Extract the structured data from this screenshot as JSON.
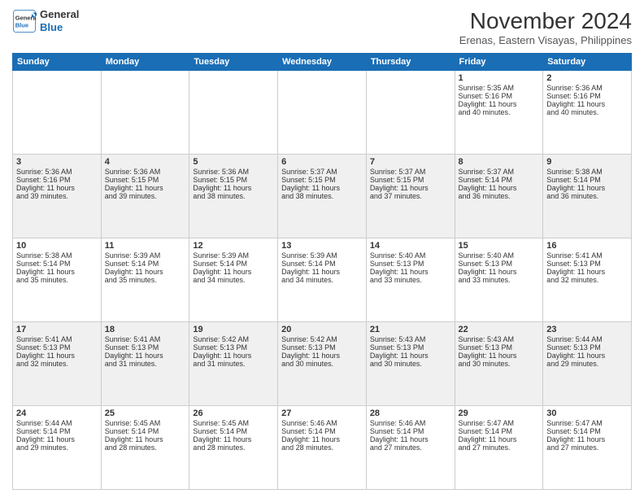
{
  "header": {
    "logo_line1": "General",
    "logo_line2": "Blue",
    "month": "November 2024",
    "location": "Erenas, Eastern Visayas, Philippines"
  },
  "weekdays": [
    "Sunday",
    "Monday",
    "Tuesday",
    "Wednesday",
    "Thursday",
    "Friday",
    "Saturday"
  ],
  "weeks": [
    [
      {
        "day": "",
        "info": ""
      },
      {
        "day": "",
        "info": ""
      },
      {
        "day": "",
        "info": ""
      },
      {
        "day": "",
        "info": ""
      },
      {
        "day": "",
        "info": ""
      },
      {
        "day": "1",
        "info": "Sunrise: 5:35 AM\nSunset: 5:16 PM\nDaylight: 11 hours\nand 40 minutes."
      },
      {
        "day": "2",
        "info": "Sunrise: 5:36 AM\nSunset: 5:16 PM\nDaylight: 11 hours\nand 40 minutes."
      }
    ],
    [
      {
        "day": "3",
        "info": "Sunrise: 5:36 AM\nSunset: 5:16 PM\nDaylight: 11 hours\nand 39 minutes."
      },
      {
        "day": "4",
        "info": "Sunrise: 5:36 AM\nSunset: 5:15 PM\nDaylight: 11 hours\nand 39 minutes."
      },
      {
        "day": "5",
        "info": "Sunrise: 5:36 AM\nSunset: 5:15 PM\nDaylight: 11 hours\nand 38 minutes."
      },
      {
        "day": "6",
        "info": "Sunrise: 5:37 AM\nSunset: 5:15 PM\nDaylight: 11 hours\nand 38 minutes."
      },
      {
        "day": "7",
        "info": "Sunrise: 5:37 AM\nSunset: 5:15 PM\nDaylight: 11 hours\nand 37 minutes."
      },
      {
        "day": "8",
        "info": "Sunrise: 5:37 AM\nSunset: 5:14 PM\nDaylight: 11 hours\nand 36 minutes."
      },
      {
        "day": "9",
        "info": "Sunrise: 5:38 AM\nSunset: 5:14 PM\nDaylight: 11 hours\nand 36 minutes."
      }
    ],
    [
      {
        "day": "10",
        "info": "Sunrise: 5:38 AM\nSunset: 5:14 PM\nDaylight: 11 hours\nand 35 minutes."
      },
      {
        "day": "11",
        "info": "Sunrise: 5:39 AM\nSunset: 5:14 PM\nDaylight: 11 hours\nand 35 minutes."
      },
      {
        "day": "12",
        "info": "Sunrise: 5:39 AM\nSunset: 5:14 PM\nDaylight: 11 hours\nand 34 minutes."
      },
      {
        "day": "13",
        "info": "Sunrise: 5:39 AM\nSunset: 5:14 PM\nDaylight: 11 hours\nand 34 minutes."
      },
      {
        "day": "14",
        "info": "Sunrise: 5:40 AM\nSunset: 5:13 PM\nDaylight: 11 hours\nand 33 minutes."
      },
      {
        "day": "15",
        "info": "Sunrise: 5:40 AM\nSunset: 5:13 PM\nDaylight: 11 hours\nand 33 minutes."
      },
      {
        "day": "16",
        "info": "Sunrise: 5:41 AM\nSunset: 5:13 PM\nDaylight: 11 hours\nand 32 minutes."
      }
    ],
    [
      {
        "day": "17",
        "info": "Sunrise: 5:41 AM\nSunset: 5:13 PM\nDaylight: 11 hours\nand 32 minutes."
      },
      {
        "day": "18",
        "info": "Sunrise: 5:41 AM\nSunset: 5:13 PM\nDaylight: 11 hours\nand 31 minutes."
      },
      {
        "day": "19",
        "info": "Sunrise: 5:42 AM\nSunset: 5:13 PM\nDaylight: 11 hours\nand 31 minutes."
      },
      {
        "day": "20",
        "info": "Sunrise: 5:42 AM\nSunset: 5:13 PM\nDaylight: 11 hours\nand 30 minutes."
      },
      {
        "day": "21",
        "info": "Sunrise: 5:43 AM\nSunset: 5:13 PM\nDaylight: 11 hours\nand 30 minutes."
      },
      {
        "day": "22",
        "info": "Sunrise: 5:43 AM\nSunset: 5:13 PM\nDaylight: 11 hours\nand 30 minutes."
      },
      {
        "day": "23",
        "info": "Sunrise: 5:44 AM\nSunset: 5:13 PM\nDaylight: 11 hours\nand 29 minutes."
      }
    ],
    [
      {
        "day": "24",
        "info": "Sunrise: 5:44 AM\nSunset: 5:14 PM\nDaylight: 11 hours\nand 29 minutes."
      },
      {
        "day": "25",
        "info": "Sunrise: 5:45 AM\nSunset: 5:14 PM\nDaylight: 11 hours\nand 28 minutes."
      },
      {
        "day": "26",
        "info": "Sunrise: 5:45 AM\nSunset: 5:14 PM\nDaylight: 11 hours\nand 28 minutes."
      },
      {
        "day": "27",
        "info": "Sunrise: 5:46 AM\nSunset: 5:14 PM\nDaylight: 11 hours\nand 28 minutes."
      },
      {
        "day": "28",
        "info": "Sunrise: 5:46 AM\nSunset: 5:14 PM\nDaylight: 11 hours\nand 27 minutes."
      },
      {
        "day": "29",
        "info": "Sunrise: 5:47 AM\nSunset: 5:14 PM\nDaylight: 11 hours\nand 27 minutes."
      },
      {
        "day": "30",
        "info": "Sunrise: 5:47 AM\nSunset: 5:14 PM\nDaylight: 11 hours\nand 27 minutes."
      }
    ]
  ]
}
